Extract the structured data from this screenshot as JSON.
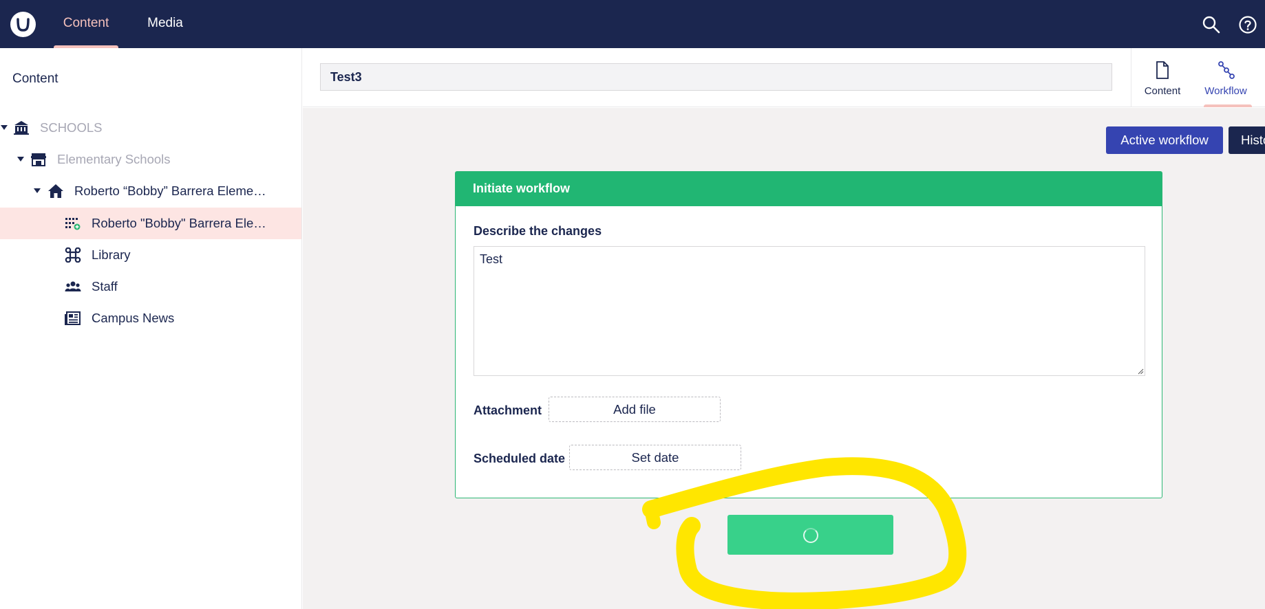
{
  "header": {
    "logo_icon": "umbraco-logo-icon",
    "nav": [
      {
        "label": "Content",
        "active": true
      },
      {
        "label": "Media",
        "active": false
      }
    ],
    "icons": [
      "search-icon",
      "help-icon"
    ]
  },
  "sidebar": {
    "title": "Content",
    "tree": [
      {
        "label": "SCHOOLS",
        "icon": "school-building-icon",
        "muted": true,
        "expanded": true
      },
      {
        "label": "Elementary Schools",
        "icon": "store-icon",
        "muted": true,
        "expanded": true
      },
      {
        "label": "Roberto “Bobby” Barrera Eleme…",
        "icon": "home-icon",
        "muted": false,
        "expanded": true
      },
      {
        "label": "Roberto \"Bobby\" Barrera Ele…",
        "icon": "grid-add-icon",
        "muted": false,
        "selected": true
      },
      {
        "label": "Library",
        "icon": "command-icon",
        "muted": false
      },
      {
        "label": "Staff",
        "icon": "users-icon",
        "muted": false
      },
      {
        "label": "Campus News",
        "icon": "newspaper-icon",
        "muted": false
      }
    ]
  },
  "editor": {
    "name_value": "Test3",
    "tabs": [
      {
        "label": "Content",
        "icon": "document-icon",
        "active": false
      },
      {
        "label": "Workflow",
        "icon": "workflow-icon",
        "active": true
      }
    ]
  },
  "main": {
    "active_workflow_label": "Active workflow",
    "history_label": "History",
    "panel": {
      "title": "Initiate workflow",
      "describe_label": "Describe the changes",
      "describe_value": "Test",
      "attachment_label": "Attachment",
      "add_file_label": "Add file",
      "scheduled_label": "Scheduled date",
      "set_date_label": "Set date"
    },
    "submit_state": "loading"
  },
  "colors": {
    "header_bg": "#1b264f",
    "accent_pink": "#f5c1bc",
    "primary_blue": "#3544b1",
    "success_green": "#21b673",
    "submit_green": "#38d18a",
    "highlight_yellow": "#ffe600"
  }
}
